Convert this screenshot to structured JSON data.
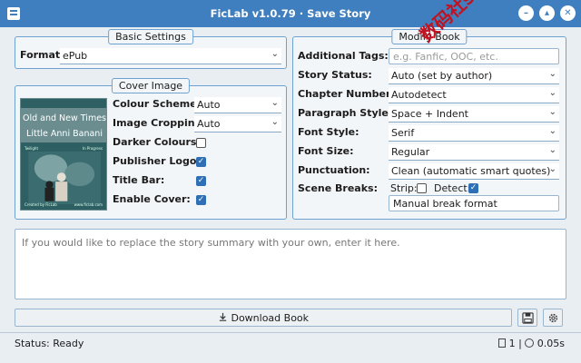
{
  "window": {
    "title": "FicLab v1.0.79 · Save Story"
  },
  "basic_settings": {
    "title": "Basic Settings",
    "format_label": "Format:",
    "format_value": "ePub"
  },
  "cover_image": {
    "title": "Cover Image",
    "cover_title": "Old and New Times",
    "cover_author": "Little Anni Banani",
    "cover_small_left": "Twilight",
    "cover_small_right": "In Progress",
    "cover_footer_left": "Created by FicLab",
    "cover_footer_right": "www.ficlab.com",
    "colour_scheme_label": "Colour Scheme:",
    "colour_scheme_value": "Auto",
    "image_cropping_label": "Image Cropping:",
    "image_cropping_value": "Auto",
    "darker_colours_label": "Darker Colours:",
    "darker_colours_checked": false,
    "publisher_logo_label": "Publisher Logo:",
    "publisher_logo_checked": true,
    "title_bar_label": "Title Bar:",
    "title_bar_checked": true,
    "enable_cover_label": "Enable Cover:",
    "enable_cover_checked": true
  },
  "modify_book": {
    "title": "Modify Book",
    "additional_tags_label": "Additional Tags:",
    "additional_tags_placeholder": "e.g. Fanfic, OOC, etc.",
    "story_status_label": "Story Status:",
    "story_status_value": "Auto (set by author)",
    "chapter_numbers_label": "Chapter Numbers:",
    "chapter_numbers_value": "Autodetect",
    "paragraph_style_label": "Paragraph Style:",
    "paragraph_style_value": "Space + Indent",
    "font_style_label": "Font Style:",
    "font_style_value": "Serif",
    "font_size_label": "Font Size:",
    "font_size_value": "Regular",
    "punctuation_label": "Punctuation:",
    "punctuation_value": "Clean (automatic smart quotes)",
    "scene_breaks_label": "Scene Breaks:",
    "strip_label": "Strip:",
    "strip_checked": false,
    "detect_label": "Detect:",
    "detect_checked": true,
    "manual_break_value": "Manual break format"
  },
  "summary": {
    "placeholder": "If you would like to replace the story summary with your own, enter it here."
  },
  "actions": {
    "download_label": "Download Book"
  },
  "status": {
    "text": "Status: Ready",
    "page_count": "1",
    "elapsed": "0.05s"
  },
  "watermark": "数码社scs66",
  "colors": {
    "accent": "#3f7fbf",
    "checked": "#2f6fb6",
    "watermark": "#c1121f"
  }
}
